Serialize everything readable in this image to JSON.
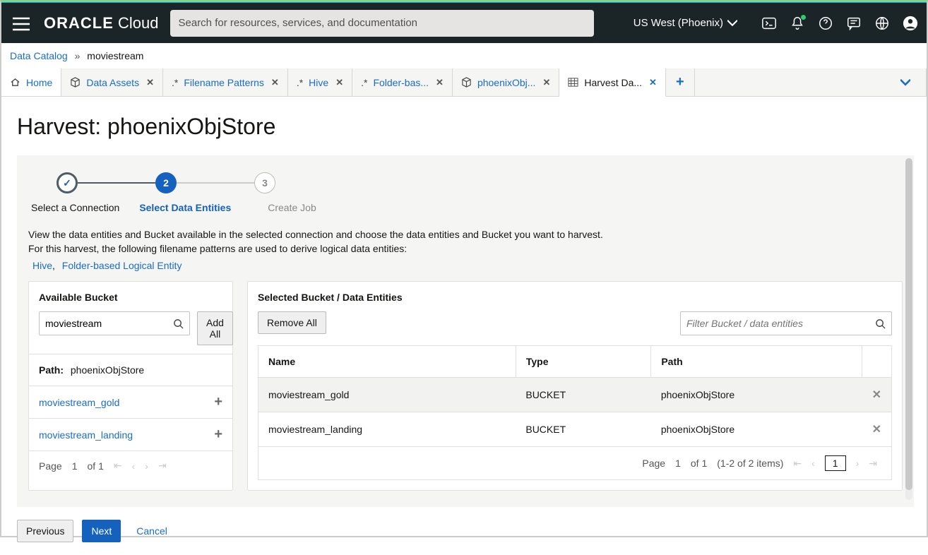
{
  "header": {
    "logo_bold": "ORACLE",
    "logo_light": "Cloud",
    "search_placeholder": "Search for resources, services, and documentation",
    "region": "US West (Phoenix)"
  },
  "breadcrumb": {
    "root": "Data Catalog",
    "current": "moviestream"
  },
  "tabs": [
    {
      "label": "Home",
      "closable": false,
      "icon": "home"
    },
    {
      "label": "Data Assets",
      "closable": true,
      "icon": "cube"
    },
    {
      "label": "Filename Patterns",
      "closable": true,
      "icon": "star"
    },
    {
      "label": "Hive",
      "closable": true,
      "icon": "star"
    },
    {
      "label": "Folder-bas...",
      "closable": true,
      "icon": "star"
    },
    {
      "label": "phoenixObj...",
      "closable": true,
      "icon": "cube"
    },
    {
      "label": "Harvest Da...",
      "closable": true,
      "icon": "grid",
      "active": true
    }
  ],
  "page": {
    "title": "Harvest: phoenixObjStore"
  },
  "stepper": {
    "steps": [
      {
        "num": "",
        "label": "Select a Connection",
        "state": "done"
      },
      {
        "num": "2",
        "label": "Select Data Entities",
        "state": "active"
      },
      {
        "num": "3",
        "label": "Create Job",
        "state": "pending"
      }
    ]
  },
  "description": {
    "line1": "View the data entities and Bucket available in the selected connection and choose the data entities and Bucket you want to harvest.",
    "line2": "For this harvest, the following filename patterns are used to derive logical data entities:",
    "patterns": [
      "Hive",
      "Folder-based Logical Entity"
    ]
  },
  "available": {
    "title": "Available Bucket",
    "search_value": "moviestream",
    "add_all": "Add All",
    "path_label": "Path:",
    "path_value": "phoenixObjStore",
    "items": [
      {
        "name": "moviestream_gold"
      },
      {
        "name": "moviestream_landing"
      }
    ],
    "pager": {
      "page_label": "Page",
      "page": "1",
      "of_label": "of 1"
    }
  },
  "selected": {
    "title": "Selected Bucket / Data Entities",
    "remove_all": "Remove All",
    "filter_placeholder": "Filter Bucket / data entities",
    "columns": {
      "name": "Name",
      "type": "Type",
      "path": "Path"
    },
    "rows": [
      {
        "name": "moviestream_gold",
        "type": "BUCKET",
        "path": "phoenixObjStore"
      },
      {
        "name": "moviestream_landing",
        "type": "BUCKET",
        "path": "phoenixObjStore"
      }
    ],
    "pager": {
      "page_label": "Page",
      "page": "1",
      "of_label": "of 1",
      "range": "(1-2 of 2 items)",
      "pagebox": "1"
    }
  },
  "footer": {
    "previous": "Previous",
    "next": "Next",
    "cancel": "Cancel"
  }
}
